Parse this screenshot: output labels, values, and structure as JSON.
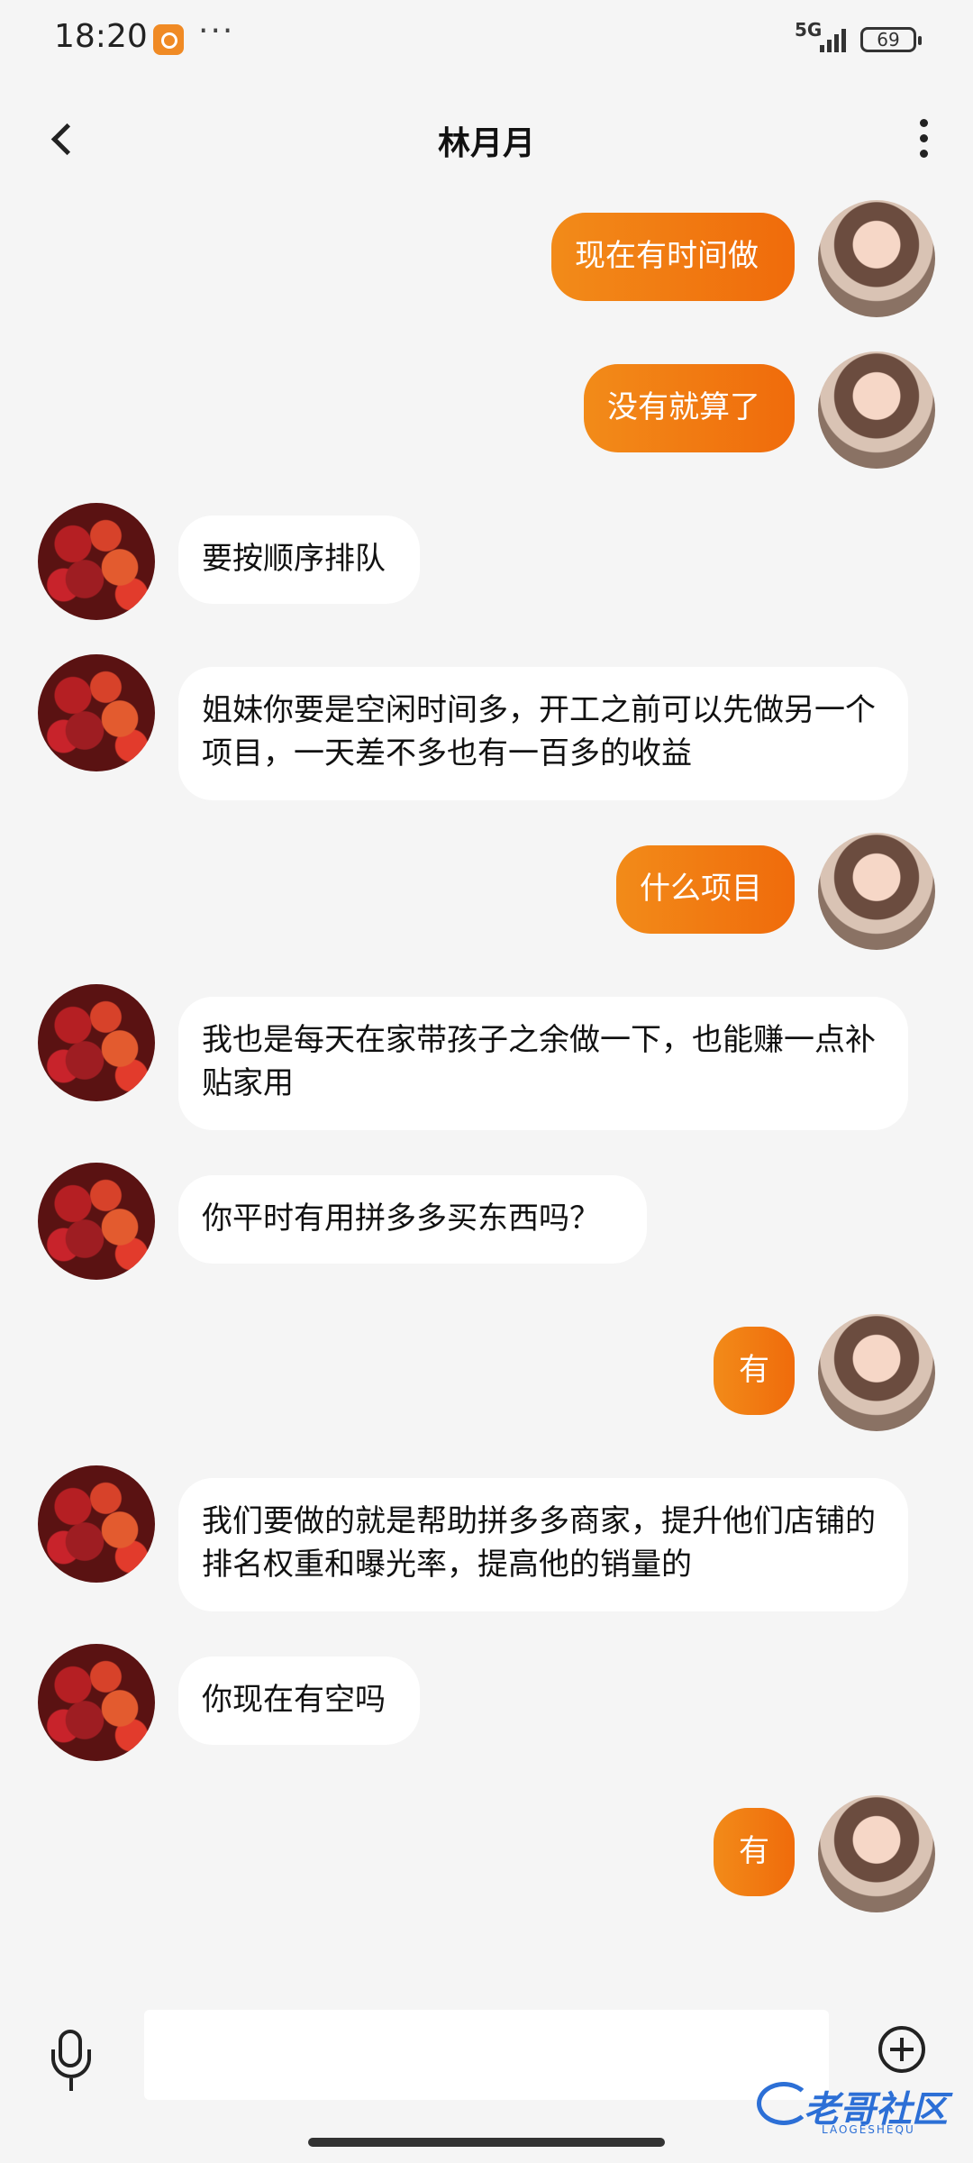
{
  "status_bar": {
    "time": "18:20",
    "network": "5G",
    "battery": "69",
    "overflow": "···"
  },
  "header": {
    "title": "林月月",
    "back_icon": "chevron-left-icon",
    "menu_icon": "vertical-dots-icon"
  },
  "messages": [
    {
      "side": "out",
      "text": "现在有时间做"
    },
    {
      "side": "out",
      "text": "没有就算了"
    },
    {
      "side": "in",
      "text": "要按顺序排队"
    },
    {
      "side": "in",
      "text": "姐妹你要是空闲时间多，开工之前可以先做另一个项目，一天差不多也有一百多的收益"
    },
    {
      "side": "out",
      "text": "什么项目"
    },
    {
      "side": "in",
      "text": "我也是每天在家带孩子之余做一下，也能赚一点补贴家用"
    },
    {
      "side": "in",
      "text": "你平时有用拼多多买东西吗？"
    },
    {
      "side": "out",
      "text": "有"
    },
    {
      "side": "in",
      "text": "我们要做的就是帮助拼多多商家，提升他们店铺的排名权重和曝光率，提高他的销量的"
    },
    {
      "side": "in",
      "text": "你现在有空吗"
    },
    {
      "side": "out",
      "text": "有"
    }
  ],
  "input_bar": {
    "placeholder": "",
    "mic_icon": "microphone-icon",
    "plus_icon": "add-circle-icon"
  },
  "watermark": {
    "text": "老哥社区",
    "sub": "LAOGESHEQU"
  },
  "colors": {
    "outgoing_bubble": "#f07a12",
    "incoming_bubble": "#ffffff",
    "background": "#f5f5f5"
  }
}
